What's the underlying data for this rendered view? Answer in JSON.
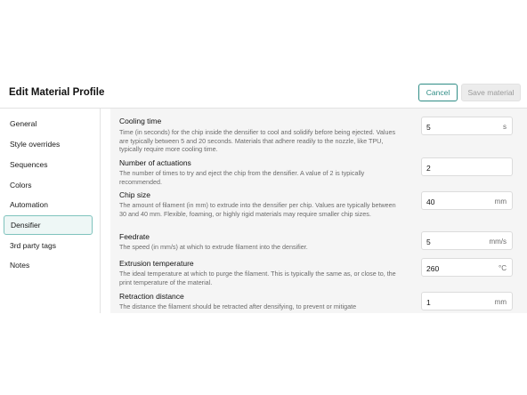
{
  "header": {
    "title": "Edit Material Profile",
    "cancel_label": "Cancel",
    "save_label": "Save material"
  },
  "sidebar": {
    "items": [
      {
        "label": "General"
      },
      {
        "label": "Style overrides"
      },
      {
        "label": "Sequences"
      },
      {
        "label": "Colors"
      },
      {
        "label": "Automation"
      },
      {
        "label": "Densifier",
        "active": true
      },
      {
        "label": "3rd party tags"
      },
      {
        "label": "Notes"
      }
    ]
  },
  "settings": [
    {
      "label": "Cooling time",
      "description": "Time (in seconds) for the chip inside the densifier to cool and solidify before being ejected. Values are typically between 5 and 20 seconds. Materials that adhere readily to the nozzle, like TPU, typically require more cooling time.",
      "value": "5",
      "unit": "s"
    },
    {
      "label": "Number of actuations",
      "description": "The number of times to try and eject the chip from the densifier. A value of 2 is typically recommended.",
      "value": "2",
      "unit": ""
    },
    {
      "label": "Chip size",
      "description": "The amount of filament (in mm) to extrude into the densifier per chip. Values are typically between 30 and 40 mm. Flexible, foaming, or highly rigid materials may require smaller chip sizes.",
      "value": "40",
      "unit": "mm"
    },
    {
      "label": "Feedrate",
      "description": "The speed (in mm/s) at which to extrude filament into the densifier.",
      "value": "5",
      "unit": "mm/s"
    },
    {
      "label": "Extrusion temperature",
      "description": "The ideal temperature at which to purge the filament. This is typically the same as, or close to, the print temperature of the material.",
      "value": "260",
      "unit": "°C"
    },
    {
      "label": "Retraction distance",
      "description": "The distance the filament should be retracted after densifying, to prevent or mitigate",
      "value": "1",
      "unit": "mm"
    }
  ],
  "colors": {
    "accent": "#2f8d86",
    "active_bg": "#eef7f6",
    "content_bg": "#f5f5f5"
  }
}
